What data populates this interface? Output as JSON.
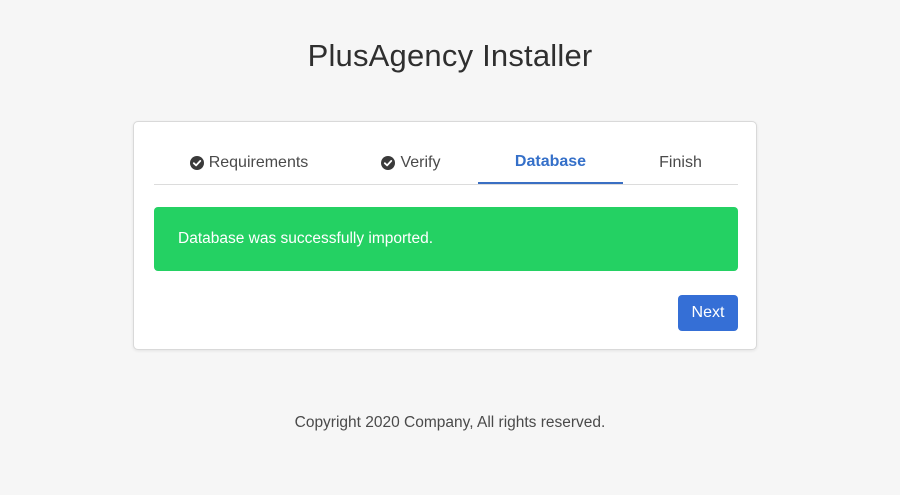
{
  "header": {
    "title": "PlusAgency Installer"
  },
  "steps": [
    {
      "label": "Requirements",
      "state": "done",
      "icon": "check-circle-icon"
    },
    {
      "label": "Verify",
      "state": "done",
      "icon": "check-circle-icon"
    },
    {
      "label": "Database",
      "state": "active"
    },
    {
      "label": "Finish",
      "state": "pending"
    }
  ],
  "alert": {
    "message": "Database was successfully imported.",
    "color": "#24d163"
  },
  "actions": {
    "next_label": "Next",
    "accent": "#356fd6"
  },
  "footer": {
    "copyright": "Copyright 2020 Company, All rights reserved."
  }
}
